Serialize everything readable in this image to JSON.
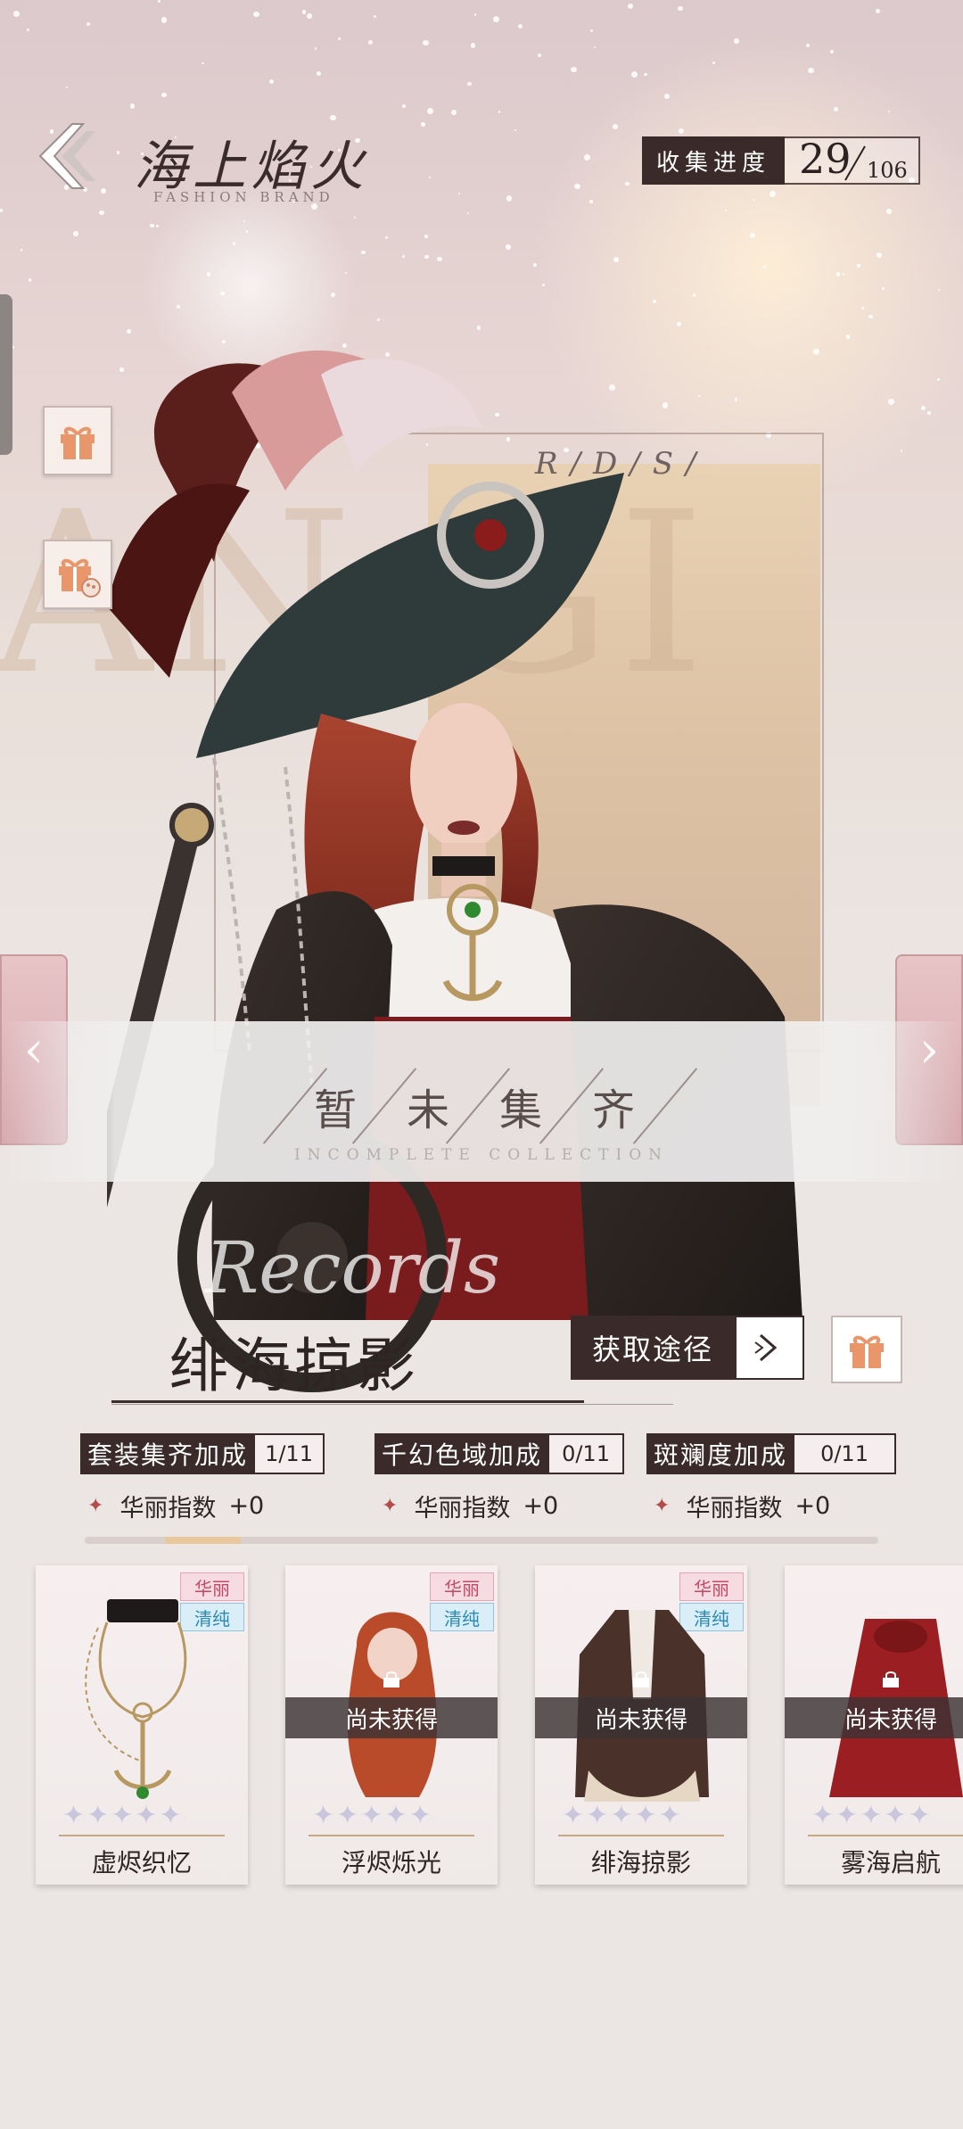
{
  "header": {
    "title": "海上焰火",
    "subtitle": "FASHION BRAND",
    "progress_label": "收集进度",
    "progress_current": "29",
    "progress_total": "106"
  },
  "background": {
    "decor_text": "AN GI",
    "decor_small": "R/D/S/"
  },
  "banner": {
    "title": "暂未集齐",
    "subtitle": "INCOMPLETE  COLLECTION"
  },
  "suit": {
    "records_text": "Records",
    "name": "绯海掠影",
    "acquire_label": "获取途径"
  },
  "bonuses": [
    {
      "label": "套装集齐加成",
      "count": "1/11",
      "stat_name": "华丽指数",
      "stat_value": "+0"
    },
    {
      "label": "千幻色域加成",
      "count": "0/11",
      "stat_name": "华丽指数",
      "stat_value": "+0"
    },
    {
      "label": "斑斓度加成",
      "count": "0/11",
      "stat_name": "华丽指数",
      "stat_value": "+0"
    }
  ],
  "cards": [
    {
      "name": "虚烬织忆",
      "tag_a": "华丽",
      "tag_b": "清纯",
      "obtained": true,
      "status": "",
      "stars": 5
    },
    {
      "name": "浮烬烁光",
      "tag_a": "华丽",
      "tag_b": "清纯",
      "obtained": false,
      "status": "尚未获得",
      "stars": 5
    },
    {
      "name": "绯海掠影",
      "tag_a": "华丽",
      "tag_b": "清纯",
      "obtained": false,
      "status": "尚未获得",
      "stars": 5
    },
    {
      "name": "雾海启航",
      "tag_a": "华丽",
      "tag_b": "清纯",
      "obtained": false,
      "status": "尚未获得",
      "stars": 5
    }
  ],
  "colors": {
    "dark_label": "#3b2a2a",
    "tag_pink": "#c24a68",
    "tag_blue": "#2b89b2",
    "nav_pink": "#d6a9ad"
  }
}
